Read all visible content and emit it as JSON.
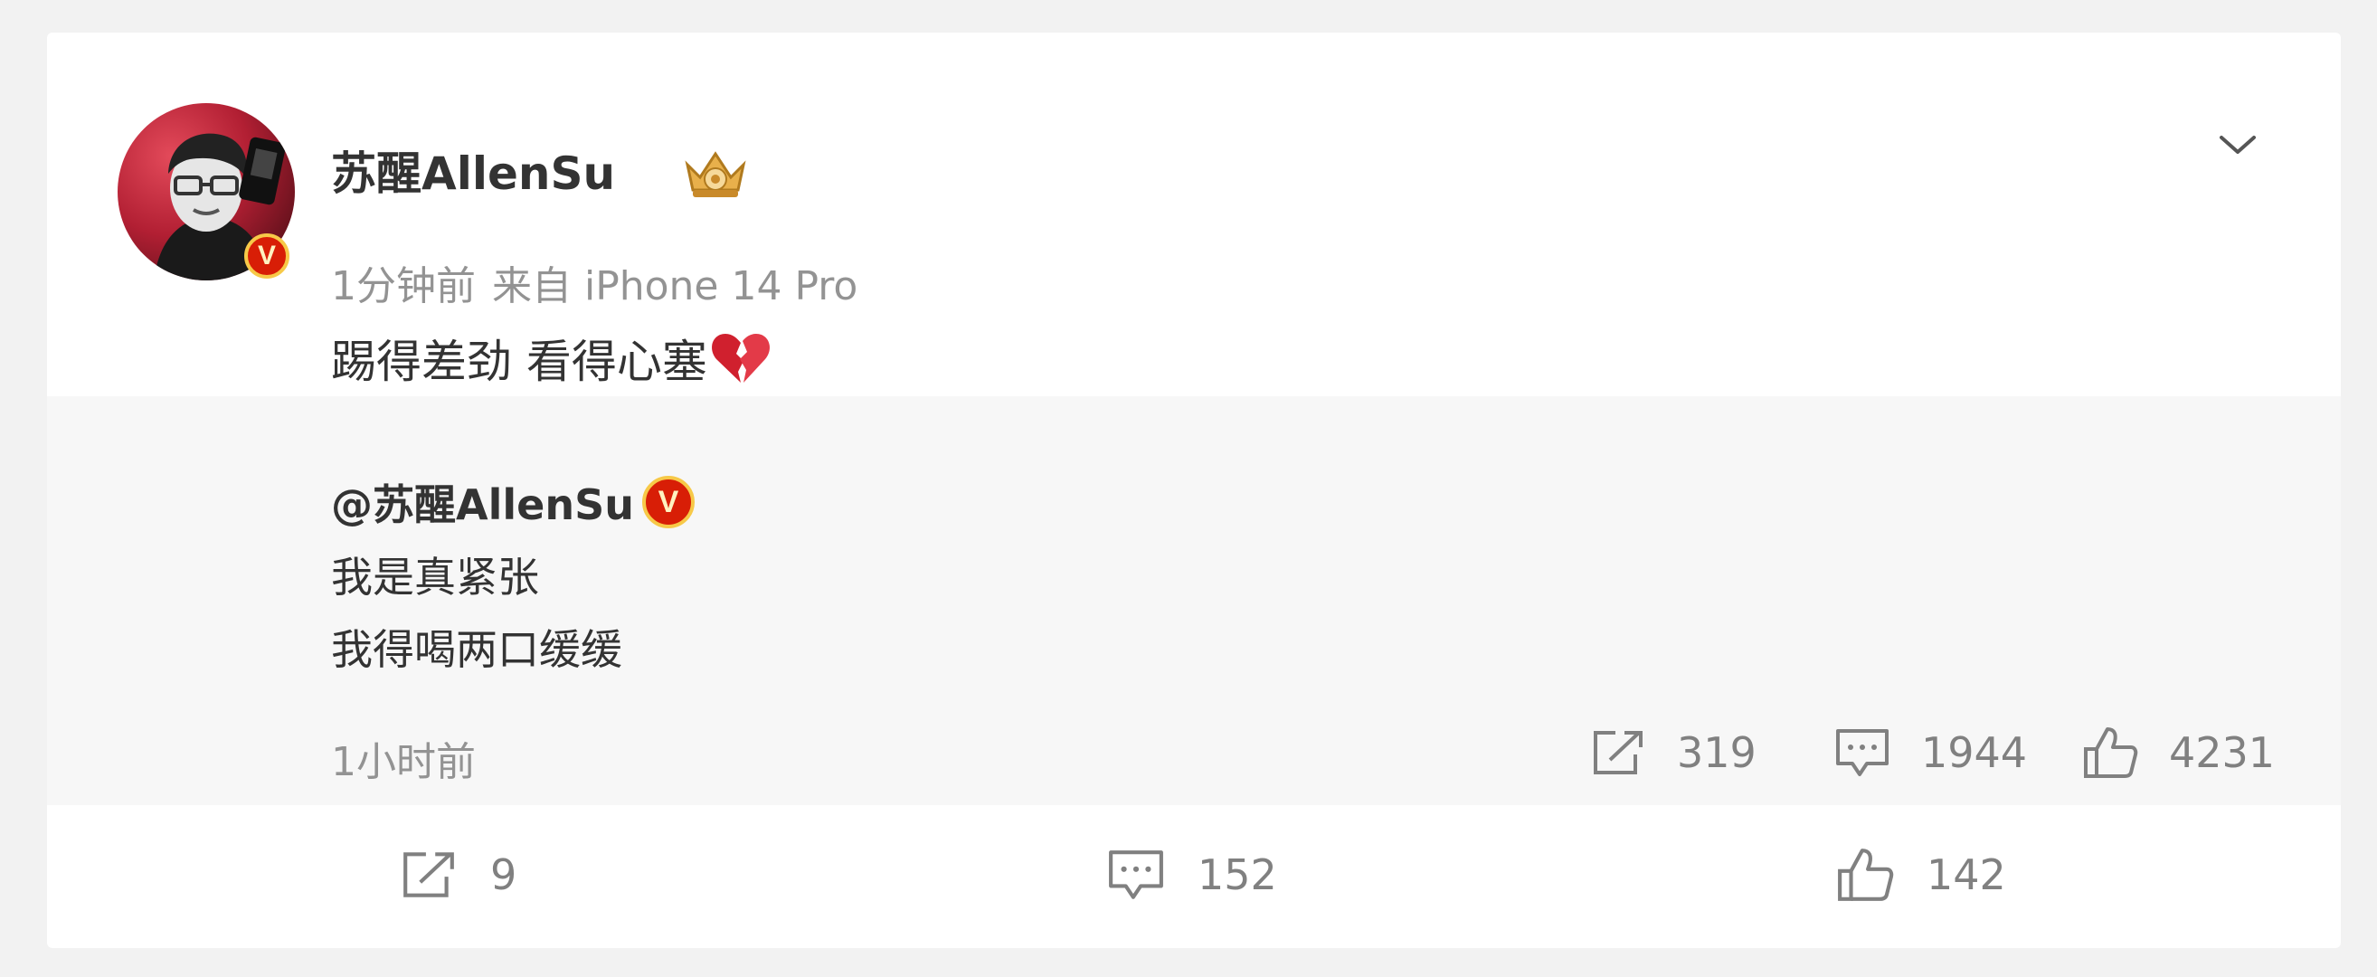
{
  "post": {
    "author": "苏醒AllenSu",
    "time": "1分钟前",
    "source": "来自 iPhone 14 Pro",
    "text": "踢得差劲 看得心塞",
    "emoji": "broken-heart-icon",
    "more_icon": "chevron-down-icon",
    "badge_icon": "verified-v-icon",
    "crown_icon": "crown-badge-icon"
  },
  "repost": {
    "author": "@苏醒AllenSu",
    "lines": [
      "我是真紧张",
      "我得喝两口缓缓"
    ],
    "time": "1小时前",
    "shares": "319",
    "comments": "1944",
    "likes": "4231"
  },
  "actions": {
    "shares": "9",
    "comments": "152",
    "likes": "142"
  },
  "colors": {
    "background": "#f2f2f2",
    "card": "#ffffff",
    "repost_bg": "#f7f7f7",
    "text": "#333333",
    "muted": "#939393",
    "icon": "#808080",
    "verified_red": "#d81e06",
    "verified_gold": "#f7c948"
  }
}
